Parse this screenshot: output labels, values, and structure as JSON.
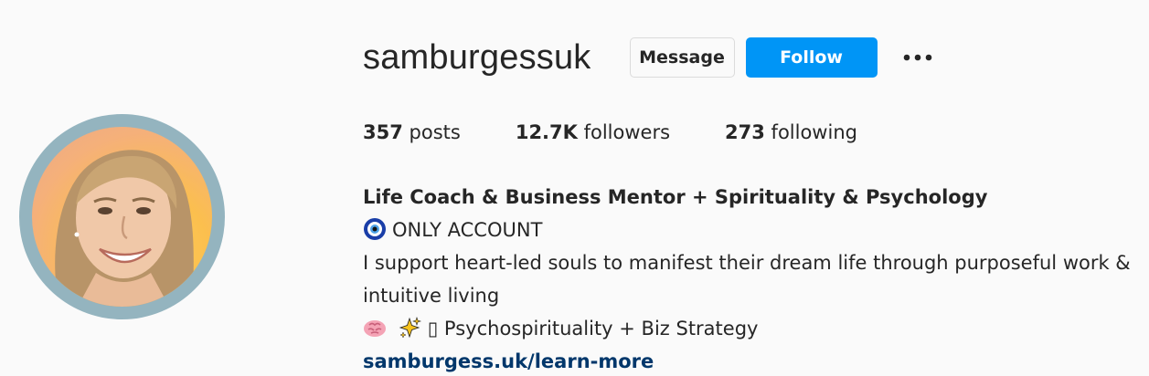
{
  "profile": {
    "username": "samburgessuk",
    "avatar_alt": "samburgessuk profile picture"
  },
  "actions": {
    "message_label": "Message",
    "follow_label": "Follow",
    "more_icon": "more-horizontal-icon"
  },
  "stats": {
    "posts_count": "357",
    "posts_label": " posts",
    "followers_count": "12.7K",
    "followers_label": " followers",
    "following_count": "273",
    "following_label": " following"
  },
  "bio": {
    "name": "Life Coach & Business Mentor + Spirituality & Psychology",
    "line1_icon": "nazar-amulet-icon",
    "line1": "ONLY ACCOUNT",
    "line2": "I support heart-led souls to manifest their dream life through purposeful work & intuitive living",
    "line3_icons": [
      "brain-icon",
      "sparkles-icon"
    ],
    "line3": "▯ Psychospirituality + Biz Strategy",
    "link": "samburgess.uk/learn-more"
  },
  "colors": {
    "follow_button": "#0095f6",
    "link": "#00376b",
    "avatar_ring": "#94b4bf",
    "background": "#fafafa"
  }
}
